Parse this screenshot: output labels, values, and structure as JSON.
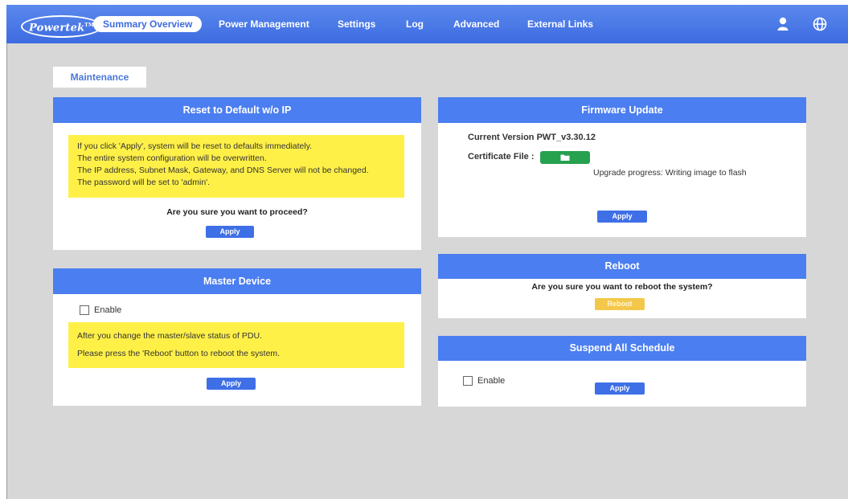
{
  "brand": {
    "logo_text": "Powertek",
    "logo_mark": "TM"
  },
  "nav": {
    "items": [
      {
        "label": "Summary Overview",
        "active": true
      },
      {
        "label": "Power Management",
        "active": false
      },
      {
        "label": "Settings",
        "active": false
      },
      {
        "label": "Log",
        "active": false
      },
      {
        "label": "Advanced",
        "active": false
      },
      {
        "label": "External Links",
        "active": false
      }
    ],
    "icons": [
      "user-icon",
      "globe-icon"
    ]
  },
  "tab": {
    "label": "Maintenance"
  },
  "reset_panel": {
    "title": "Reset to Default w/o IP",
    "note_lines": [
      "If you click 'Apply', system will be reset to defaults immediately.",
      "The entire system configuration will be overwritten.",
      "The IP address, Subnet Mask, Gateway, and DNS Server will not be changed.",
      "The password will be set to 'admin'."
    ],
    "question": "Are you sure you want to proceed?",
    "apply_label": "Apply"
  },
  "master_panel": {
    "title": "Master Device",
    "checkbox_label": "Enable",
    "checked": false,
    "note_lines": [
      "After you change the master/slave status of PDU.",
      "Please press the 'Reboot' button to reboot the system."
    ],
    "apply_label": "Apply"
  },
  "firmware_panel": {
    "title": "Firmware Update",
    "current_version": "Current Version PWT_v3.30.12",
    "certificate_label": "Certificate File :",
    "progress_text": "Upgrade progress: Writing image to flash",
    "apply_label": "Apply"
  },
  "reboot_panel": {
    "title": "Reboot",
    "question": "Are you sure you want to reboot the system?",
    "reboot_label": "Reboot"
  },
  "suspend_panel": {
    "title": "Suspend All Schedule",
    "checkbox_label": "Enable",
    "checked": false,
    "apply_label": "Apply"
  },
  "colors": {
    "nav_bg": "#3d6be0",
    "panel_header": "#4b7ef0",
    "note_bg": "#fff048",
    "page_bg": "#d7d7d7",
    "apply_button": "#3f6fe6",
    "reboot_button": "#f3c84a",
    "file_button": "#26a14e"
  }
}
